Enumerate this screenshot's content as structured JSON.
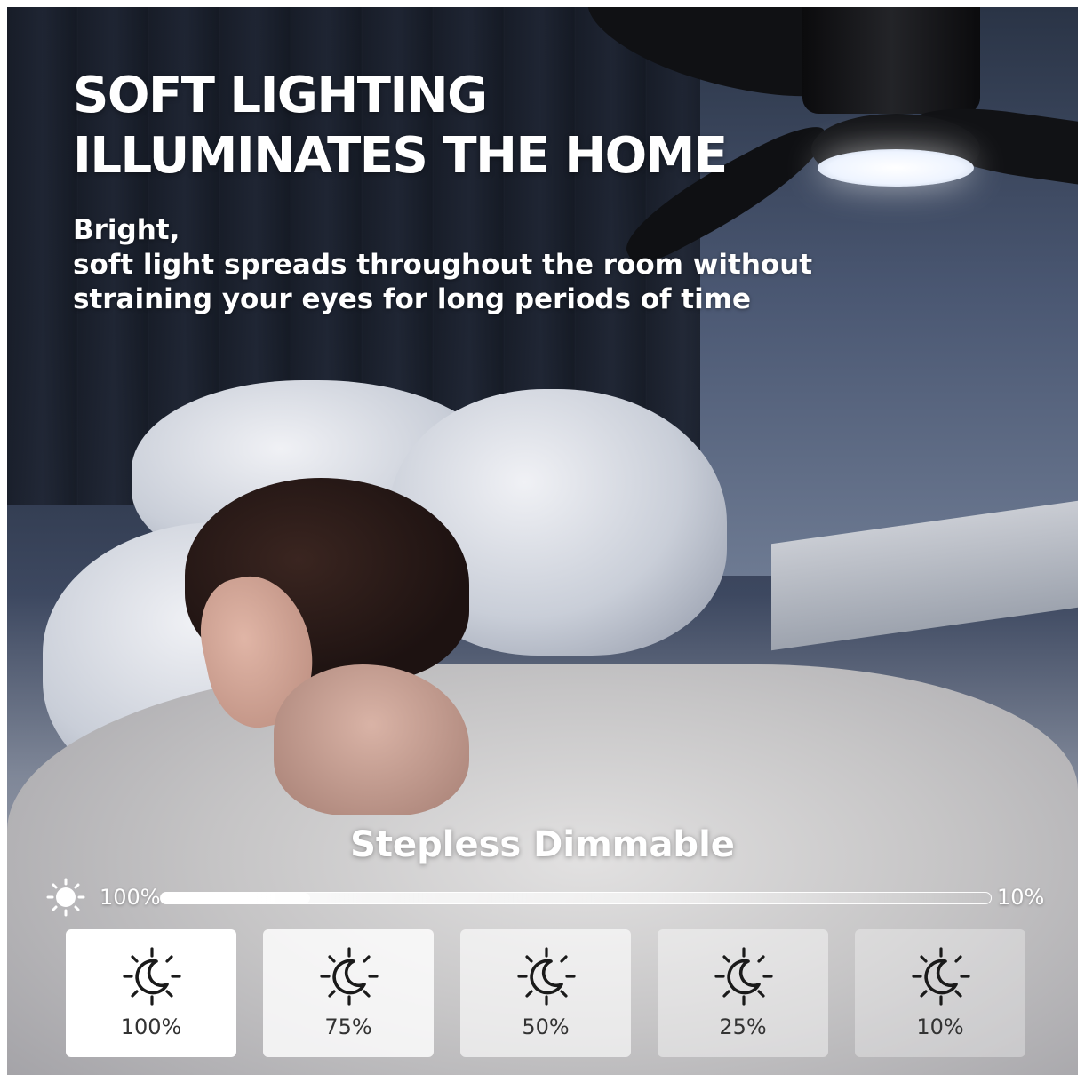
{
  "headline": {
    "line1": "SOFT LIGHTING",
    "line2": "ILLUMINATES THE HOME"
  },
  "subtext": {
    "line1": "Bright,",
    "line2": "soft light spreads throughout the room without",
    "line3": "straining your eyes for long periods of time"
  },
  "dimming": {
    "title": "Stepless Dimmable",
    "slider_max_label": "100%",
    "slider_min_label": "10%",
    "sun_icon": "sun-icon",
    "level_icon": "sun-moon-icon",
    "levels": [
      {
        "label": "100%",
        "value": 100
      },
      {
        "label": "75%",
        "value": 75
      },
      {
        "label": "50%",
        "value": 50
      },
      {
        "label": "25%",
        "value": 25
      },
      {
        "label": "10%",
        "value": 10
      }
    ]
  },
  "colors": {
    "text": "#ffffff",
    "card_text": "#333333",
    "icon": "#1a1a1a"
  }
}
